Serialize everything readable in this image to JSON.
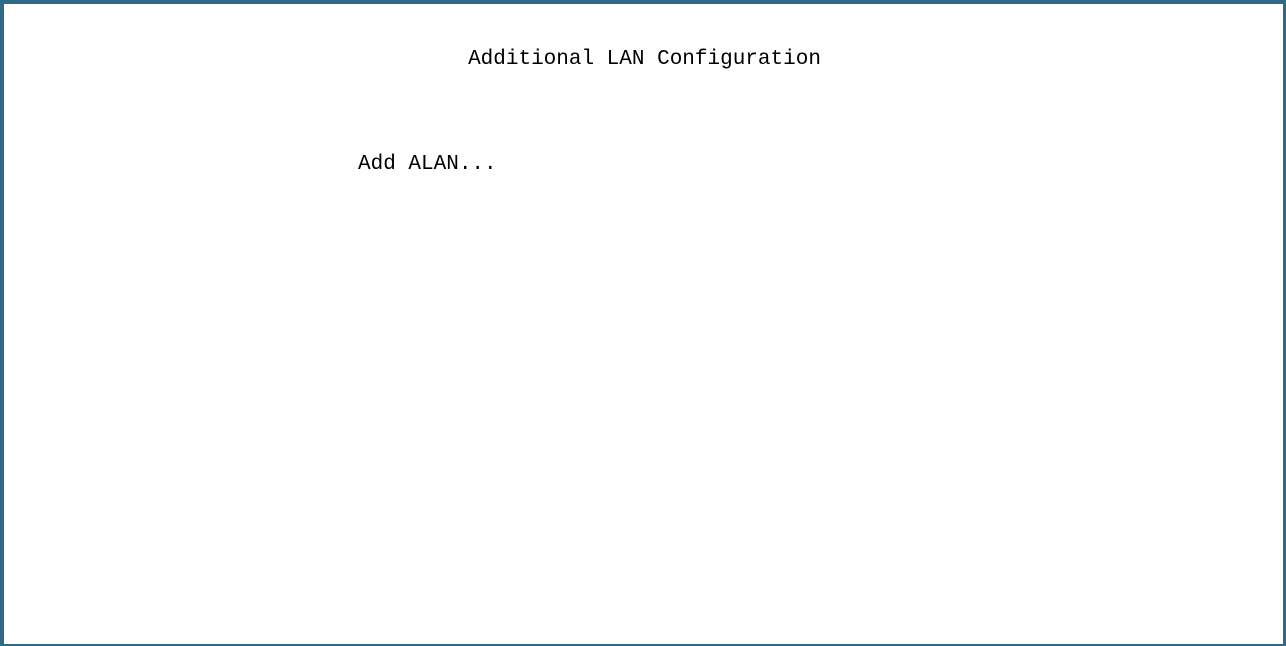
{
  "screen": {
    "title": "Additional LAN Configuration",
    "menu": {
      "items": [
        {
          "label": "Add ALAN..."
        }
      ]
    }
  },
  "colors": {
    "border": "#2e6a85",
    "background": "#ffffff",
    "text": "#000000"
  }
}
